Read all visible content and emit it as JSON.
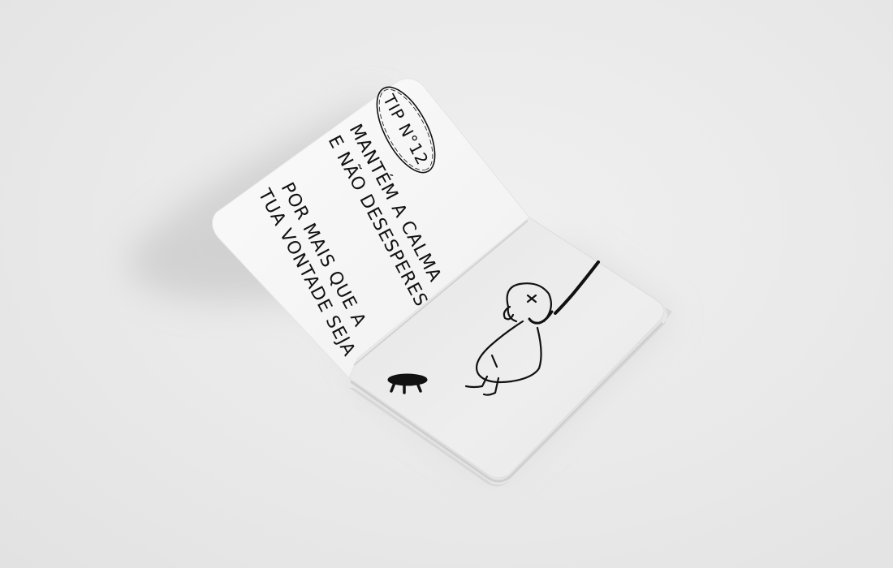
{
  "booklet": {
    "stamp": "TIP N°12",
    "line_1": "MANTÉM A CALMA",
    "line_2": "E NÃO DESESPERES",
    "line_3": "POR MAIS QUE A",
    "line_4": "TUA VONTADE SEJA"
  },
  "illustration": {
    "figure": "hanged-stick-figure",
    "stool": "fallen-stool"
  },
  "colors": {
    "background": "#e9e9e9",
    "left_page": "#f7f7f7",
    "right_page": "#ececec",
    "ink": "#111111"
  }
}
